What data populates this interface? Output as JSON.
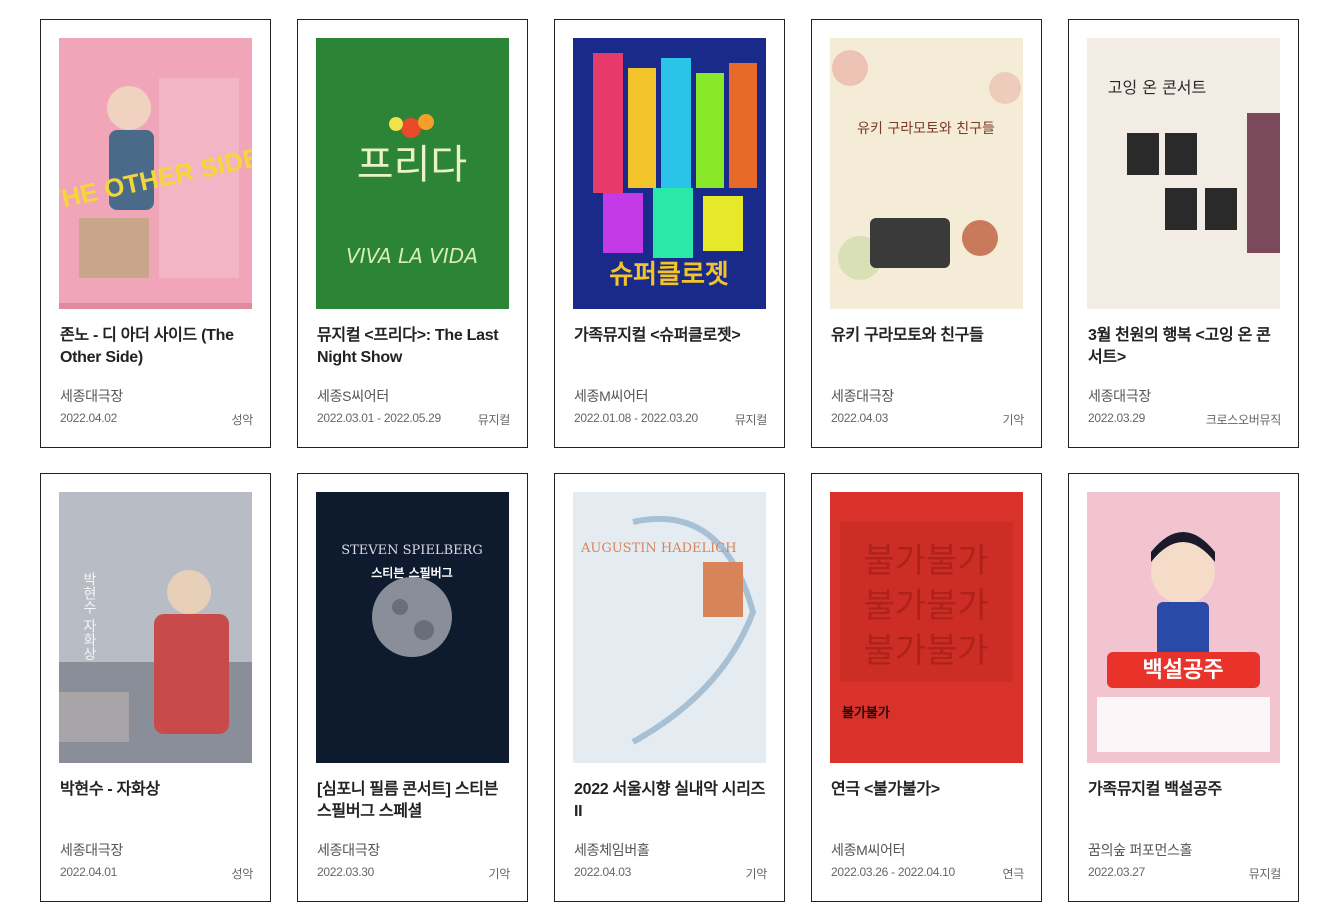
{
  "events": [
    {
      "title": "존노 - 디 아더 사이드 (The Other Side)",
      "venue": "세종대극장",
      "date": "2022.04.02",
      "genre": "성악",
      "poster_text": "THE OTHER SIDE",
      "colors": {
        "bg": "#f0a5b8",
        "accent": "#f5d63a",
        "figure": "#4a6a8a"
      }
    },
    {
      "title": "뮤지컬 <프리다>: The Last Night Show",
      "venue": "세종S씨어터",
      "date": "2022.03.01 - 2022.05.29",
      "genre": "뮤지컬",
      "poster_text": "프리다",
      "poster_sub": "VIVA LA VIDA",
      "colors": {
        "bg": "#2e8a3a",
        "accent": "#e9f2c8",
        "figure": "#1f6a2a"
      }
    },
    {
      "title": "가족뮤지컬 <슈퍼클로젯>",
      "venue": "세종M씨어터",
      "date": "2022.01.08 - 2022.03.20",
      "genre": "뮤지컬",
      "poster_text": "슈퍼클로젯",
      "colors": {
        "bg": "#1a2a8a",
        "accent": "#f2c42a",
        "figure": "#e83a6a"
      }
    },
    {
      "title": "유키 구라모토와 친구들",
      "venue": "세종대극장",
      "date": "2022.04.03",
      "genre": "기악",
      "poster_text": "유키 구라모토와 친구들",
      "colors": {
        "bg": "#f4ecd6",
        "accent": "#7a3a2a",
        "figure": "#c87a5a"
      }
    },
    {
      "title": "3월 천원의 행복 <고잉 온 콘서트>",
      "venue": "세종대극장",
      "date": "2022.03.29",
      "genre": "크로스오버뮤직",
      "poster_text": "고잉 온 콘서트",
      "colors": {
        "bg": "#6a3a4a",
        "accent": "#f2ece4",
        "figure": "#2a2a2a"
      }
    },
    {
      "title": "박현수 - 자화상",
      "venue": "세종대극장",
      "date": "2022.04.01",
      "genre": "성악",
      "poster_text": "박현수 자화상",
      "colors": {
        "bg": "#b8bcc4",
        "accent": "#c84a4a",
        "figure": "#6a6a7a"
      }
    },
    {
      "title": "[심포니 필름 콘서트] 스티븐 스필버그 스페셜",
      "venue": "세종대극장",
      "date": "2022.03.30",
      "genre": "기악",
      "poster_text": "STEVEN SPIELBERG",
      "poster_sub": "스티븐 스필버그",
      "colors": {
        "bg": "#0e1a2e",
        "accent": "#d8dce4",
        "figure": "#8a8e98"
      }
    },
    {
      "title": "2022 서울시향 실내악 시리즈 II",
      "venue": "세종체임버홀",
      "date": "2022.04.03",
      "genre": "기악",
      "poster_text": "AUGUSTIN HADELICH",
      "colors": {
        "bg": "#e4ecf2",
        "accent": "#d8845a",
        "figure": "#6a8aa8"
      }
    },
    {
      "title": "연극 <불가불가>",
      "venue": "세종M씨어터",
      "date": "2022.03.26 - 2022.04.10",
      "genre": "연극",
      "poster_text": "불가불가",
      "colors": {
        "bg": "#d8322a",
        "accent": "#a8201a",
        "figure": "#6a1a14"
      }
    },
    {
      "title": "가족뮤지컬 백설공주",
      "venue": "꿈의숲 퍼포먼스홀",
      "date": "2022.03.27",
      "genre": "뮤지컬",
      "poster_text": "백설공주",
      "colors": {
        "bg": "#f2c4d0",
        "accent": "#e8322a",
        "figure": "#2a4aa8"
      }
    }
  ]
}
